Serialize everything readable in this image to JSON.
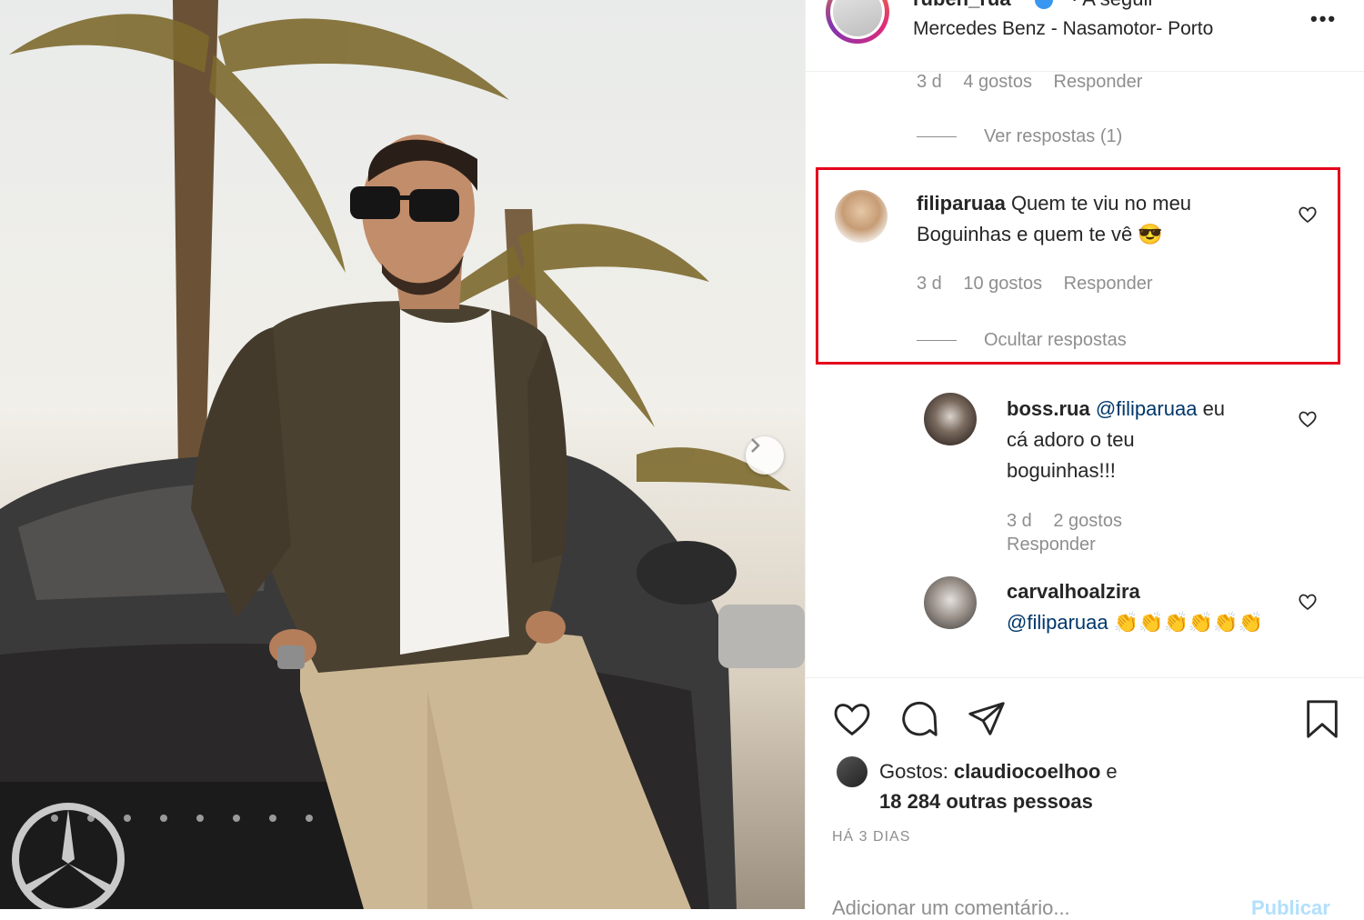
{
  "post": {
    "username": "ruben_rua",
    "follow_label": "· A seguir",
    "location": "Mercedes Benz - Nasamotor- Porto",
    "more_label": "•••"
  },
  "comments": {
    "prev_meta": {
      "time": "3 d",
      "likes": "4 gostos",
      "reply": "Responder"
    },
    "prev_view_replies": "Ver respostas (1)",
    "highlighted": {
      "username": "filiparuaa",
      "text_line1": "Quem te viu no meu",
      "text_line2": "Boguinhas e quem te vê 😎",
      "time": "3 d",
      "likes": "10 gostos",
      "reply": "Responder",
      "hide_replies": "Ocultar respostas"
    },
    "reply1": {
      "username": "boss.rua",
      "mention": "@filiparuaa",
      "text_line1_rest": " eu",
      "text_line2": "cá adoro o teu",
      "text_line3": "boguinhas!!!",
      "time": "3 d",
      "likes": "2 gostos",
      "reply": "Responder"
    },
    "reply2": {
      "username": "carvalhoalzira",
      "mention": "@filiparuaa",
      "text_rest": " 👏👏👏👏👏👏"
    }
  },
  "footer": {
    "likes_prefix": "Gostos: ",
    "likes_user": "claudiocoelhoo",
    "likes_and": " e",
    "likes_count": "18 284 outras pessoas",
    "date": "HÁ 3 DIAS",
    "add_comment_placeholder": "Adicionar um comentário...",
    "publish_label": "Publicar"
  },
  "colors": {
    "highlight_border": "#e4001b",
    "mention": "#00376b",
    "muted": "#8e8e8e"
  }
}
